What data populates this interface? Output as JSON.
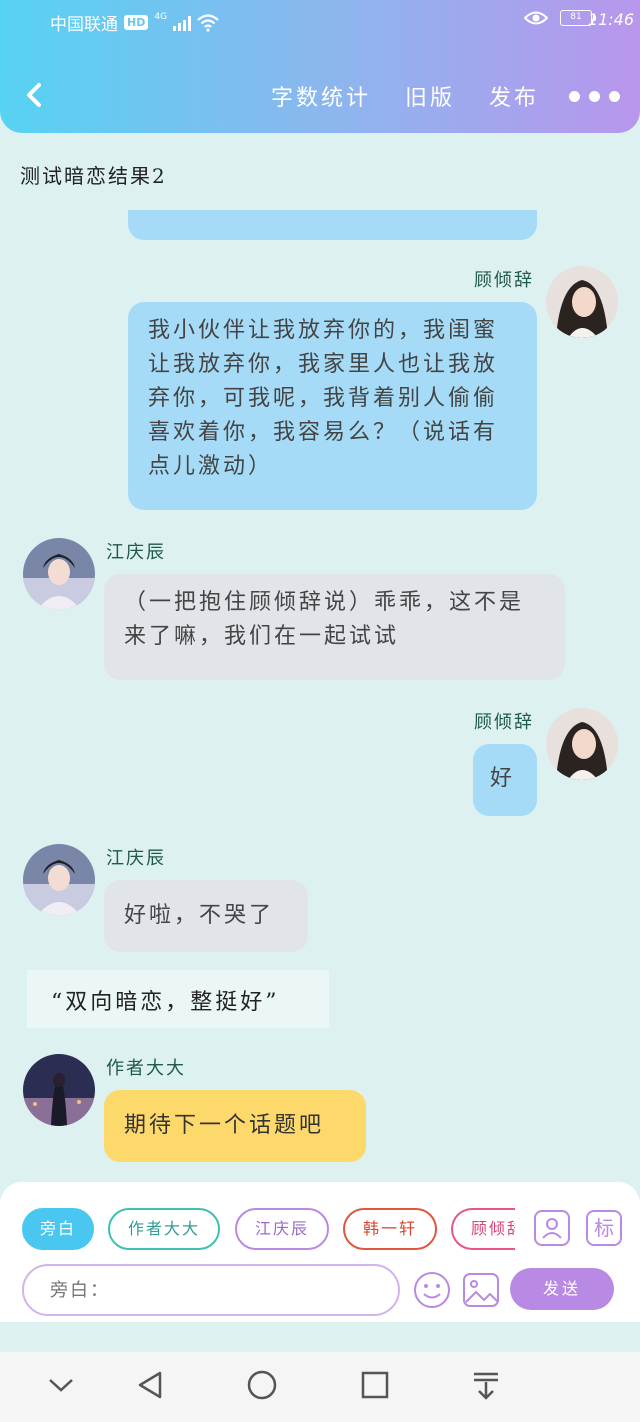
{
  "status_bar": {
    "carrier": "中国联通",
    "hd": "HD",
    "network": "4G",
    "battery": "81",
    "time": "11:46"
  },
  "header": {
    "word_count": "字数统计",
    "old_version": "旧版",
    "publish": "发布"
  },
  "chat_title": "测试暗恋结果2",
  "messages": {
    "m1": {
      "name": "顾倾辞",
      "text": "我小伙伴让我放弃你的，我闺蜜让我放弃你，我家里人也让我放弃你，可我呢，我背着别人偷偷喜欢着你，我容易么？（说话有点儿激动）"
    },
    "m2": {
      "name": "江庆辰",
      "text": "（一把抱住顾倾辞说）乖乖，这不是来了嘛，我们在一起试试"
    },
    "m3": {
      "name": "顾倾辞",
      "text": "好"
    },
    "m4": {
      "name": "江庆辰",
      "text": "好啦，不哭了"
    },
    "narration": "“双向暗恋，整挺好”",
    "m5": {
      "name": "作者大大",
      "text": "期待下一个话题吧"
    }
  },
  "composer": {
    "chips": [
      "旁白",
      "作者大大",
      "江庆辰",
      "韩一轩",
      "顾倾辞"
    ],
    "mark_label": "标",
    "placeholder": "旁白：",
    "send": "发送"
  },
  "colors": {
    "header_start": "#56d2f2",
    "header_end": "#b896ec",
    "chat_bg": "#ddf1f1",
    "blue_bubble": "#a6dbf8",
    "grey_bubble": "#e1e5ea",
    "yellow_bubble": "#fdd96b",
    "accent_purple": "#b98ae3"
  }
}
